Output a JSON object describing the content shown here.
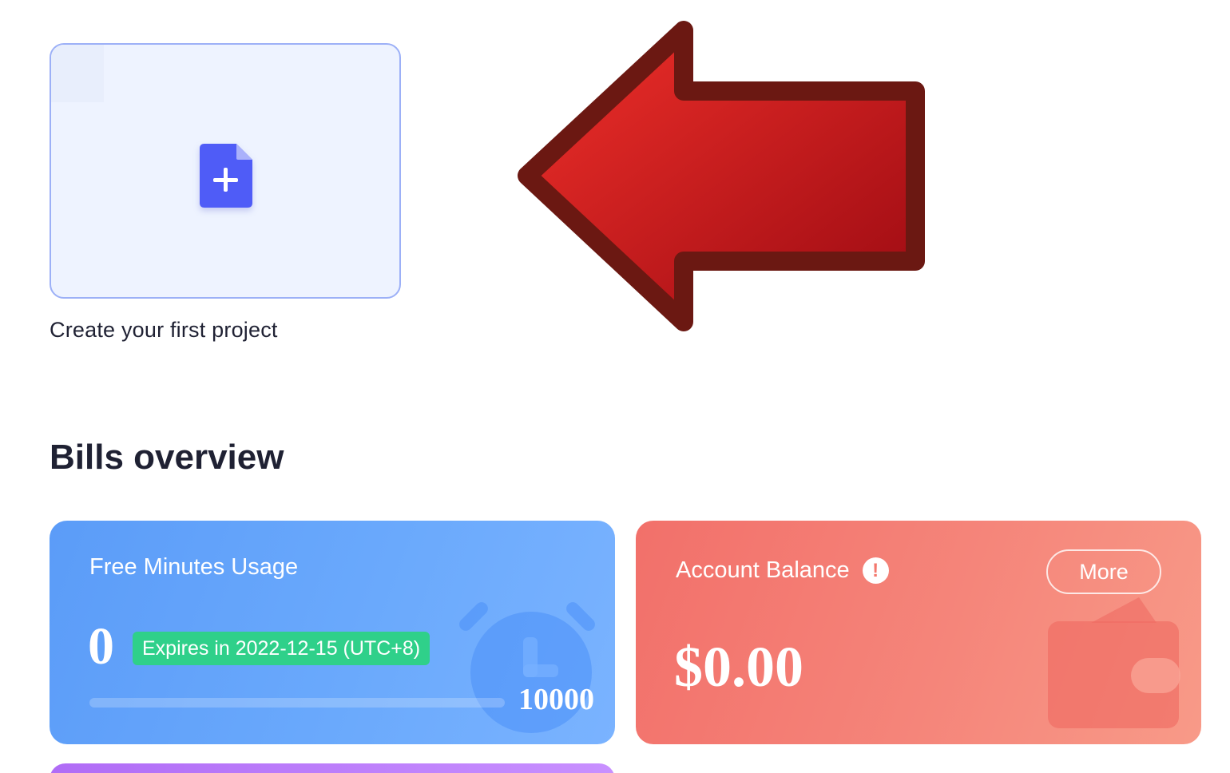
{
  "create_project": {
    "label": "Create your first project",
    "icon": "file-plus-icon",
    "accent": "#4f5cf7"
  },
  "annotation": {
    "icon": "red-left-arrow",
    "fill": "#d41a1f",
    "stroke": "#6b1812"
  },
  "bills": {
    "title": "Bills overview",
    "usage": {
      "title": "Free Minutes Usage",
      "value": "0",
      "expires": "Expires in 2022-12-15 (UTC+8)",
      "total": "10000",
      "progress": 0,
      "icon": "clock-icon",
      "color": "#5b9cf8"
    },
    "balance": {
      "title": "Account Balance",
      "info_icon": "!",
      "more_label": "More",
      "amount": "$0.00",
      "icon": "wallet-icon",
      "color": "#f2706a"
    }
  }
}
